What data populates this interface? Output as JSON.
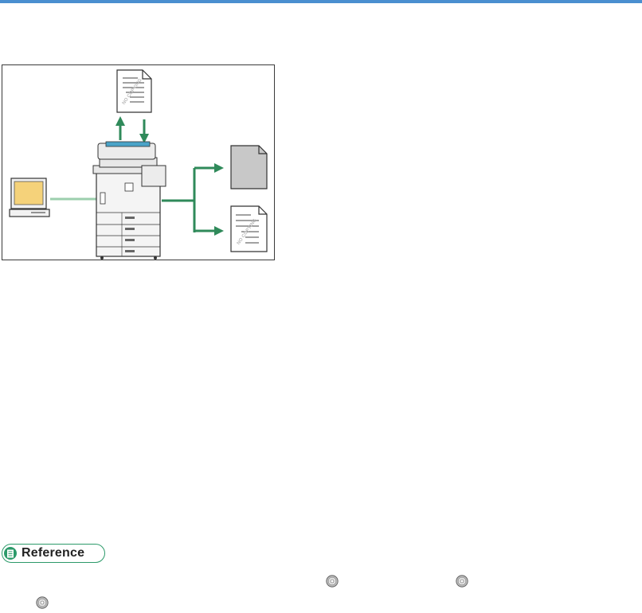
{
  "page": {
    "accent_color": "#4a8fd0"
  },
  "figure": {
    "document_watermark": "NO COPYING",
    "arrow_color": "#2f8a5a",
    "cable_color": "#9ccfae",
    "printer_tray_color": "#4aa3c8"
  },
  "reference": {
    "label": "Reference",
    "border_color": "#2c9a6a",
    "icon": "document-icon"
  },
  "cd_icons": [
    "cd-icon",
    "cd-icon",
    "cd-icon"
  ]
}
